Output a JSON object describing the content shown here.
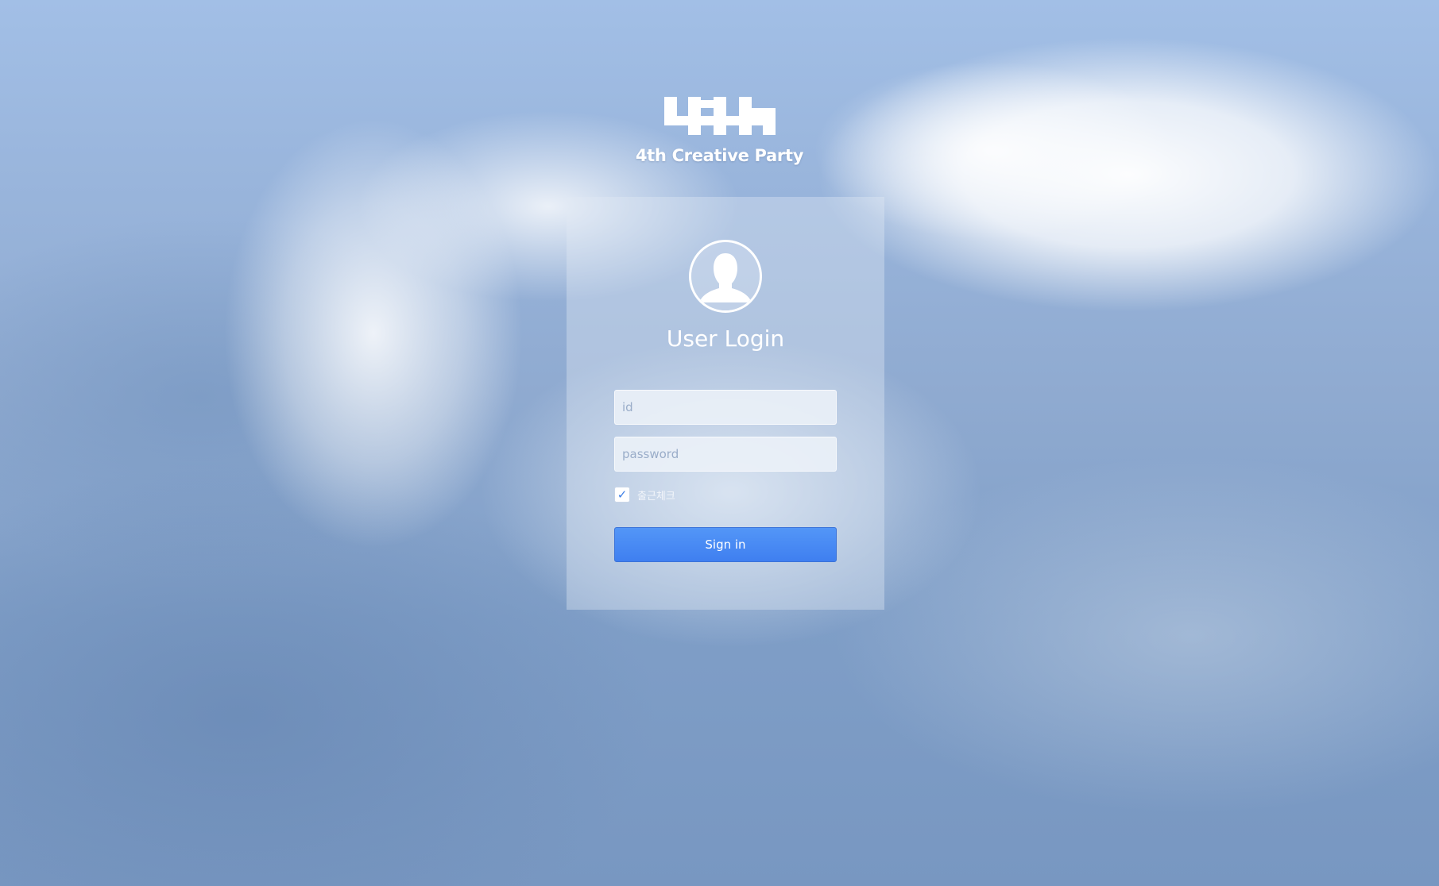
{
  "brand": {
    "name": "4th Creative Party",
    "logo_icon": "4th-logo-icon"
  },
  "login": {
    "avatar_icon": "user-avatar-icon",
    "title": "User Login",
    "id_placeholder": "id",
    "id_value": "",
    "password_placeholder": "password",
    "password_value": "",
    "attendance_checked": true,
    "attendance_label": "출근체크",
    "submit_label": "Sign in"
  },
  "colors": {
    "accent": "#4a8cf2",
    "text_light": "#ffffff"
  }
}
